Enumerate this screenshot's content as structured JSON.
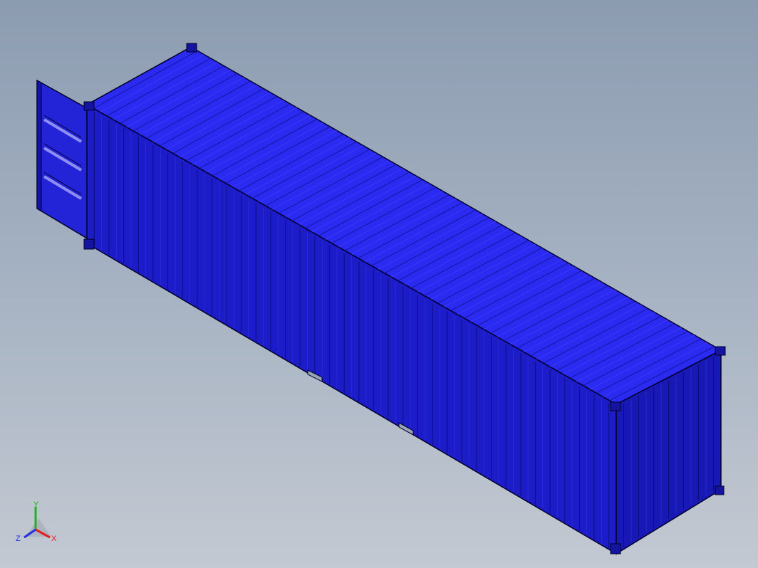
{
  "viewport": {
    "background_top": "#8c9cb0",
    "background_bottom": "#c3c9d2"
  },
  "model": {
    "name": "shipping-container",
    "body_color": "#1f1fd6",
    "roof_color": "#2a2af0",
    "edge_color": "#000033",
    "state": "rear door open"
  },
  "triad": {
    "x_label": "X",
    "y_label": "Y",
    "z_label": "Z",
    "x_color": "#e02020",
    "y_color": "#20b020",
    "z_color": "#2030e0"
  }
}
